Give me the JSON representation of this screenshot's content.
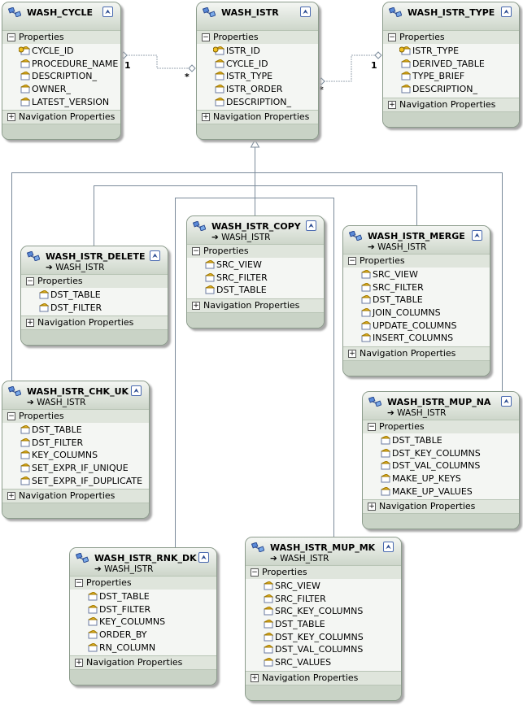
{
  "sections": {
    "properties": "Properties",
    "navigation": "Navigation Properties"
  },
  "colors": {
    "line": "#7a8a9a",
    "header": "#cdd6ca",
    "section": "#dfe5dc"
  },
  "entities": [
    {
      "id": "wash_cycle",
      "name": "WASH_CYCLE",
      "base": "",
      "properties": [
        {
          "name": "CYCLE_ID",
          "key": true
        },
        {
          "name": "PROCEDURE_NAME"
        },
        {
          "name": "DESCRIPTION_"
        },
        {
          "name": "OWNER_"
        },
        {
          "name": "LATEST_VERSION"
        }
      ]
    },
    {
      "id": "wash_istr",
      "name": "WASH_ISTR",
      "base": "",
      "properties": [
        {
          "name": "ISTR_ID",
          "key": true
        },
        {
          "name": "CYCLE_ID"
        },
        {
          "name": "ISTR_TYPE"
        },
        {
          "name": "ISTR_ORDER"
        },
        {
          "name": "DESCRIPTION_"
        }
      ]
    },
    {
      "id": "wash_istr_type",
      "name": "WASH_ISTR_TYPE",
      "base": "",
      "properties": [
        {
          "name": "ISTR_TYPE",
          "key": true
        },
        {
          "name": "DERIVED_TABLE"
        },
        {
          "name": "TYPE_BRIEF"
        },
        {
          "name": "DESCRIPTION_"
        }
      ]
    },
    {
      "id": "wash_istr_delete",
      "name": "WASH_ISTR_DELETE",
      "base": "WASH_ISTR",
      "properties": [
        {
          "name": "DST_TABLE"
        },
        {
          "name": "DST_FILTER"
        }
      ]
    },
    {
      "id": "wash_istr_copy",
      "name": "WASH_ISTR_COPY",
      "base": "WASH_ISTR",
      "properties": [
        {
          "name": "SRC_VIEW"
        },
        {
          "name": "SRC_FILTER"
        },
        {
          "name": "DST_TABLE"
        }
      ]
    },
    {
      "id": "wash_istr_merge",
      "name": "WASH_ISTR_MERGE",
      "base": "WASH_ISTR",
      "properties": [
        {
          "name": "SRC_VIEW"
        },
        {
          "name": "SRC_FILTER"
        },
        {
          "name": "DST_TABLE"
        },
        {
          "name": "JOIN_COLUMNS"
        },
        {
          "name": "UPDATE_COLUMNS"
        },
        {
          "name": "INSERT_COLUMNS"
        }
      ]
    },
    {
      "id": "wash_istr_chk_uk",
      "name": "WASH_ISTR_CHK_UK",
      "base": "WASH_ISTR",
      "properties": [
        {
          "name": "DST_TABLE"
        },
        {
          "name": "DST_FILTER"
        },
        {
          "name": "KEY_COLUMNS"
        },
        {
          "name": "SET_EXPR_IF_UNIQUE"
        },
        {
          "name": "SET_EXPR_IF_DUPLICATE"
        }
      ]
    },
    {
      "id": "wash_istr_mup_na",
      "name": "WASH_ISTR_MUP_NA",
      "base": "WASH_ISTR",
      "properties": [
        {
          "name": "DST_TABLE"
        },
        {
          "name": "DST_KEY_COLUMNS"
        },
        {
          "name": "DST_VAL_COLUMNS"
        },
        {
          "name": "MAKE_UP_KEYS"
        },
        {
          "name": "MAKE_UP_VALUES"
        }
      ]
    },
    {
      "id": "wash_istr_rnk_dk",
      "name": "WASH_ISTR_RNK_DK",
      "base": "WASH_ISTR",
      "properties": [
        {
          "name": "DST_TABLE"
        },
        {
          "name": "DST_FILTER"
        },
        {
          "name": "KEY_COLUMNS"
        },
        {
          "name": "ORDER_BY"
        },
        {
          "name": "RN_COLUMN"
        }
      ]
    },
    {
      "id": "wash_istr_mup_mk",
      "name": "WASH_ISTR_MUP_MK",
      "base": "WASH_ISTR",
      "properties": [
        {
          "name": "SRC_VIEW"
        },
        {
          "name": "SRC_FILTER"
        },
        {
          "name": "SRC_KEY_COLUMNS"
        },
        {
          "name": "DST_TABLE"
        },
        {
          "name": "DST_KEY_COLUMNS"
        },
        {
          "name": "DST_VAL_COLUMNS"
        },
        {
          "name": "SRC_VALUES"
        }
      ]
    }
  ],
  "associations": [
    {
      "from": "WASH_CYCLE",
      "to": "WASH_ISTR",
      "from_mult": "1",
      "to_mult": "*"
    },
    {
      "from": "WASH_ISTR_TYPE",
      "to": "WASH_ISTR",
      "from_mult": "1",
      "to_mult": "*"
    }
  ]
}
